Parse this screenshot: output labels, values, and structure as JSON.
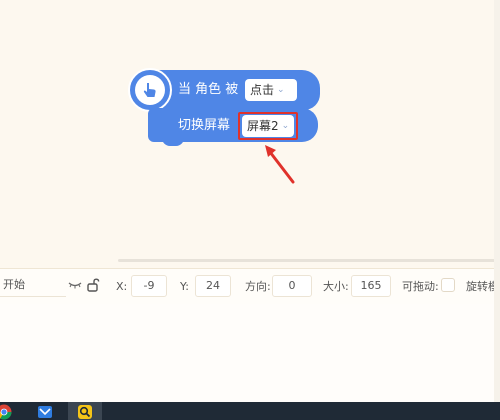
{
  "hat_block": {
    "text": "当 角色 被",
    "dropdown_value": "点击"
  },
  "command_block": {
    "text": "切换屏幕",
    "dropdown_value": "屏幕2"
  },
  "properties": {
    "name_value": "开始",
    "x_label": "X:",
    "x_value": "-9",
    "y_label": "Y:",
    "y_value": "24",
    "direction_label": "方向:",
    "direction_value": "0",
    "size_label": "大小:",
    "size_value": "165",
    "draggable_label": "可拖动:",
    "rotation_label": "旋转模"
  },
  "colors": {
    "block_blue": "#4f86e6",
    "highlight_red": "#e0322b",
    "canvas_bg": "#fdf8ef"
  },
  "taskbar": {
    "icons": [
      "chrome-icon",
      "mail-app-icon",
      "search-app-icon"
    ]
  }
}
